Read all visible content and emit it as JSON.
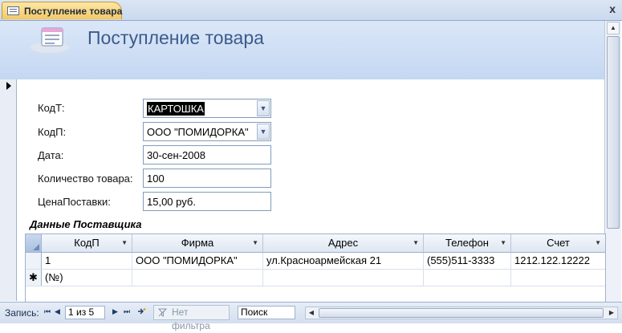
{
  "tab": {
    "label": "Поступление товара",
    "close": "x"
  },
  "header": {
    "title": "Поступление товара"
  },
  "form": {
    "kodt": {
      "label": "КодТ:",
      "value": "КАРТОШКА"
    },
    "kodp": {
      "label": "КодП:",
      "value": "ООО \"ПОМИДОРКА\""
    },
    "date": {
      "label": "Дата:",
      "value": "30-сен-2008"
    },
    "qty": {
      "label": "Количество товара:",
      "value": "100"
    },
    "price": {
      "label": "ЦенаПоставки:",
      "value": "15,00 руб."
    }
  },
  "subform": {
    "title": "Данные Поставщика",
    "columns": [
      "КодП",
      "Фирма",
      "Адрес",
      "Телефон",
      "Счет"
    ],
    "rows": [
      {
        "kodp": "1",
        "firm": "ООО \"ПОМИДОРКА\"",
        "address": "ул.Красноармейская 21",
        "phone": "(555)511-3333",
        "account": "1212.122.12222"
      }
    ],
    "new_row_marker": "✱",
    "new_row_placeholder": "(№)"
  },
  "navbar": {
    "label": "Запись:",
    "current": "1 из 5",
    "filter": "Нет фильтра",
    "search": "Поиск"
  },
  "icons": {
    "first": "⏮",
    "prev": "◀",
    "next": "▶",
    "last": "⏭",
    "dropdown": "▼",
    "up": "▲"
  }
}
